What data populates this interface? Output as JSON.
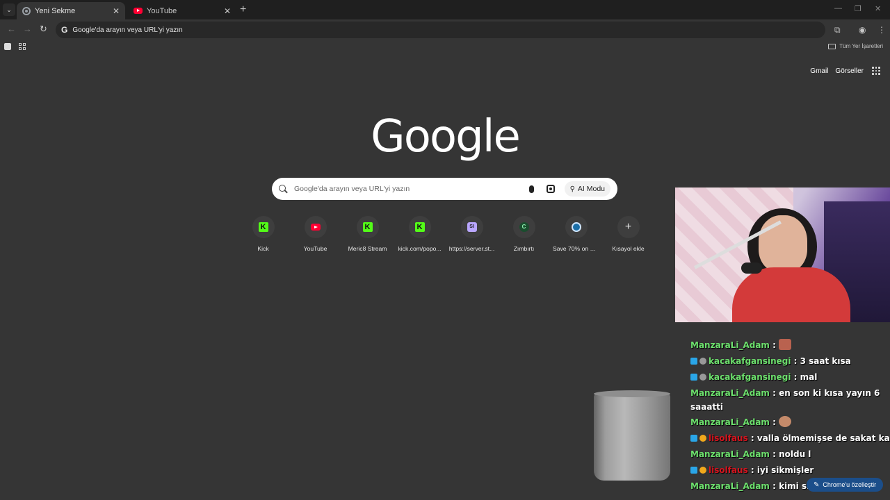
{
  "tabs": [
    {
      "label": "Yeni Sekme",
      "icon": "chrome-icon"
    },
    {
      "label": "YouTube",
      "icon": "youtube-icon"
    }
  ],
  "omnibox": {
    "text": "Google'da arayın veya URL'yi yazın"
  },
  "bookmarks": {
    "all_label": "Tüm Yer İşaretleri"
  },
  "header_links": {
    "gmail": "Gmail",
    "images": "Görseller"
  },
  "logo": "Google",
  "search": {
    "placeholder": "Google'da arayın veya URL'yi yazın",
    "ai_mode": "AI Modu"
  },
  "shortcuts": [
    {
      "label": "Kick",
      "icon": "kick-icon"
    },
    {
      "label": "YouTube",
      "icon": "youtube-icon"
    },
    {
      "label": "Meric8 Stream",
      "icon": "kick-icon"
    },
    {
      "label": "kick.com/popo...",
      "icon": "kick-icon"
    },
    {
      "label": "https://server.st...",
      "icon": "server-icon"
    },
    {
      "label": "Zımbırtı",
      "icon": "c-icon"
    },
    {
      "label": "Save 70% on Fr...",
      "icon": "steam-icon"
    },
    {
      "label": "Kısayol ekle",
      "icon": "plus-icon"
    }
  ],
  "chat": [
    {
      "user": "ManzaraLi_Adam",
      "color": "#6de06d",
      "message": "",
      "emote": true
    },
    {
      "user": "kacakafgansinegi",
      "color": "#6de06d",
      "message": "3 saat kısa",
      "badges": true
    },
    {
      "user": "kacakafgansinegi",
      "color": "#6de06d",
      "message": "mal",
      "badges": true
    },
    {
      "user": "ManzaraLi_Adam",
      "color": "#6de06d",
      "message": "en son ki kısa yayın 6 saaatti",
      "wrap": true
    },
    {
      "user": "ManzaraLi_Adam",
      "color": "#6de06d",
      "message": "",
      "emote_face": true
    },
    {
      "user": "lisolfaus",
      "color": "#d4141e",
      "message": "valla ölmemişse de sakat kalmış",
      "badges2": true
    },
    {
      "user": "ManzaraLi_Adam",
      "color": "#6de06d",
      "message": "noldu l"
    },
    {
      "user": "lisolfaus",
      "color": "#d4141e",
      "message": "iyi sikmişler",
      "badges2": true
    },
    {
      "user": "ManzaraLi_Adam",
      "color": "#6de06d",
      "message": "kimi sikmişler"
    }
  ],
  "customize": {
    "label": "Chrome'u özelleştir"
  }
}
